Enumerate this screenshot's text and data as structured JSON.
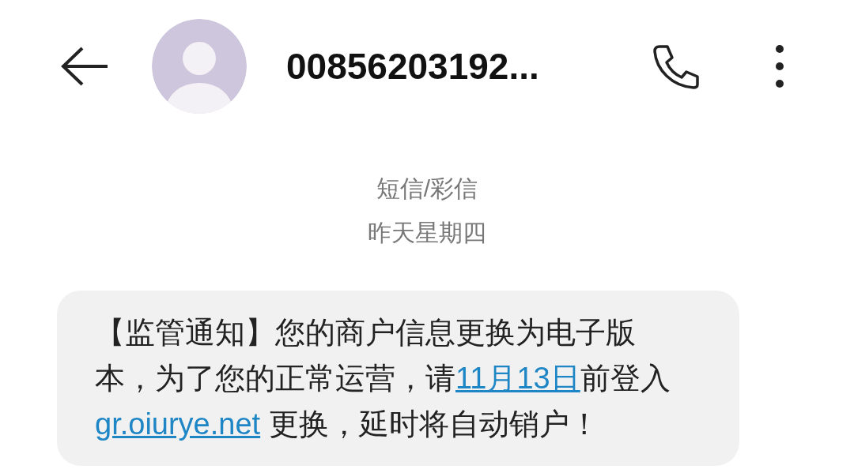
{
  "header": {
    "title": "00856203192..."
  },
  "meta": [
    "短信/彩信",
    "昨天星期四"
  ],
  "message": {
    "segments": [
      {
        "kind": "text",
        "text": "【监管通知】您的商户信息更换为电子版本，为了您的正常运营，请"
      },
      {
        "kind": "link",
        "text": "11月13日"
      },
      {
        "kind": "text",
        "text": "前登入"
      },
      {
        "kind": "link",
        "text": "gr.oiurye.net"
      },
      {
        "kind": "text",
        "text": " 更换，延时将自动销户！"
      }
    ]
  }
}
